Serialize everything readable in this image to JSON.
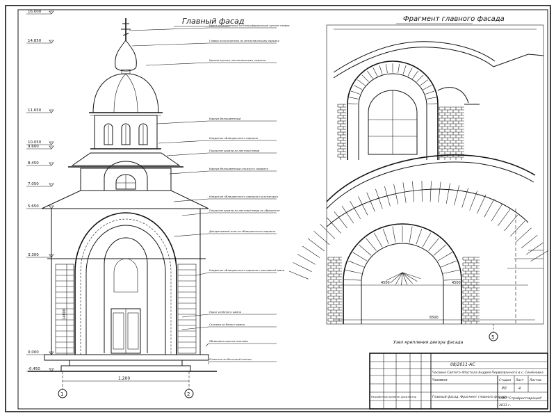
{
  "sheet": {
    "border_color": "#000000",
    "paper_color": "#ffffff",
    "ink_color": "#111111"
  },
  "left_view": {
    "title": "Главный фасад",
    "levels": [
      "16.000",
      "14.850",
      "11.650",
      "10.050",
      "9.600",
      "8.450",
      "7.050",
      "5.650",
      "3.300",
      "0.000",
      "-0.450"
    ],
    "annotations": [
      "Крест позолоченный на полусферическом куполе главки",
      "Главка позолоченная по металлическому каркасу",
      "Кровля купола, металлическая, окраска",
      "Карниз белокаменный",
      "Кладка из облицовочного кирпича",
      "Покрытие кровли из листовой меди",
      "Карниз белокаменный сложного профиля",
      "Кладка из облицовочного кирпича и штукатурка",
      "Покрытие кровли из листовой меди по обрешетке",
      "Декоративный пояс из облицовочного кирпича",
      "Кладка из облицовочного кирпича с расшивкой швов",
      "Порог из белого камня",
      "Ступени из белого камня",
      "Облицовка цоколя плитами",
      "Отмостка из бетонной плитки"
    ],
    "dim_bottom": "1.200",
    "axes": [
      "1",
      "2"
    ],
    "dim_vertical": "14800"
  },
  "right_view": {
    "title": "Фрагмент главного фасада",
    "caption": "Узел крепления декора фасада",
    "axis": "5",
    "dims": [
      "4500",
      "4500",
      "6500"
    ]
  },
  "title_block": {
    "code": "08/2011-АС",
    "project": "Часовня Святого Апостола Андрея Первозванного в с. Семёновка",
    "stage": "Часовня",
    "sheet_title": "Главный фасад. Фрагмент главного фасада",
    "author_note": "Разработчик проекта: Архитектор",
    "organization": "ООО \"Стройреставрация\"",
    "year": "2011 г.",
    "col_stage": "Стадия",
    "col_sheet": "Лист",
    "col_sheets": "Листов",
    "val_stage": "РП",
    "val_sheet": "4"
  }
}
